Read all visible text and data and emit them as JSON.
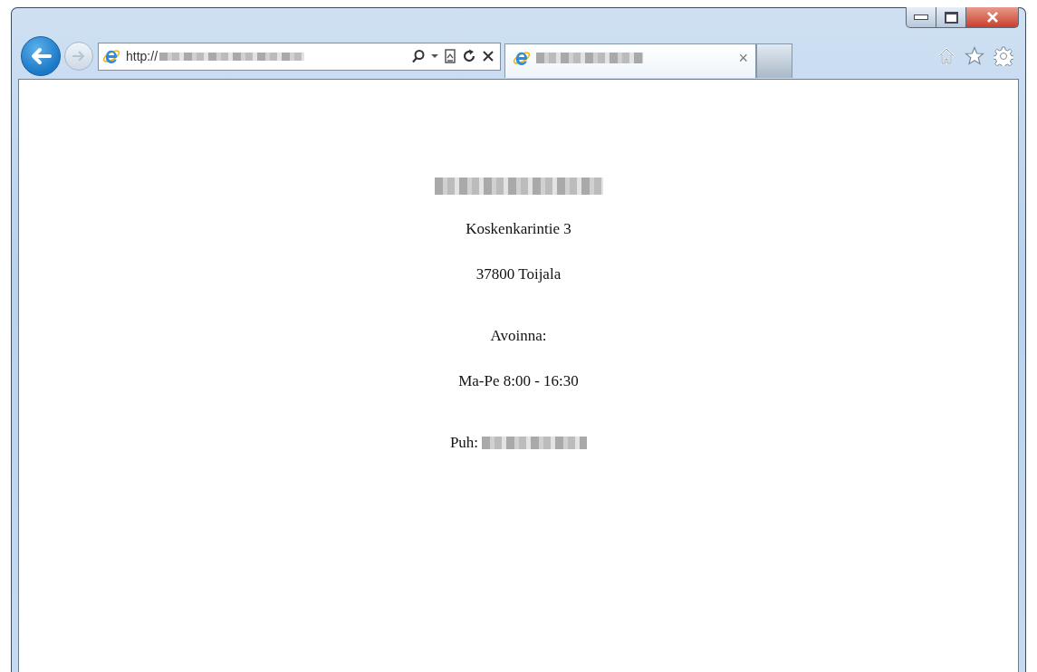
{
  "address_bar": {
    "text": "http://"
  },
  "tab": {
    "selected": true,
    "close": "×"
  },
  "content": {
    "blocks": [
      {
        "lines": [
          {
            "kind": "plain",
            "text": "Koskenkarintie 3"
          },
          {
            "kind": "plain",
            "text": "37800 Toijala"
          }
        ]
      },
      {
        "lines": [
          {
            "kind": "plain",
            "text": "Avoinna:"
          },
          {
            "kind": "plain",
            "text": "Ma-Pe 8:00 - 16:30"
          }
        ]
      },
      {
        "lines": [
          {
            "kind": "blurred_suffix",
            "text": "Puh:"
          }
        ]
      }
    ]
  }
}
